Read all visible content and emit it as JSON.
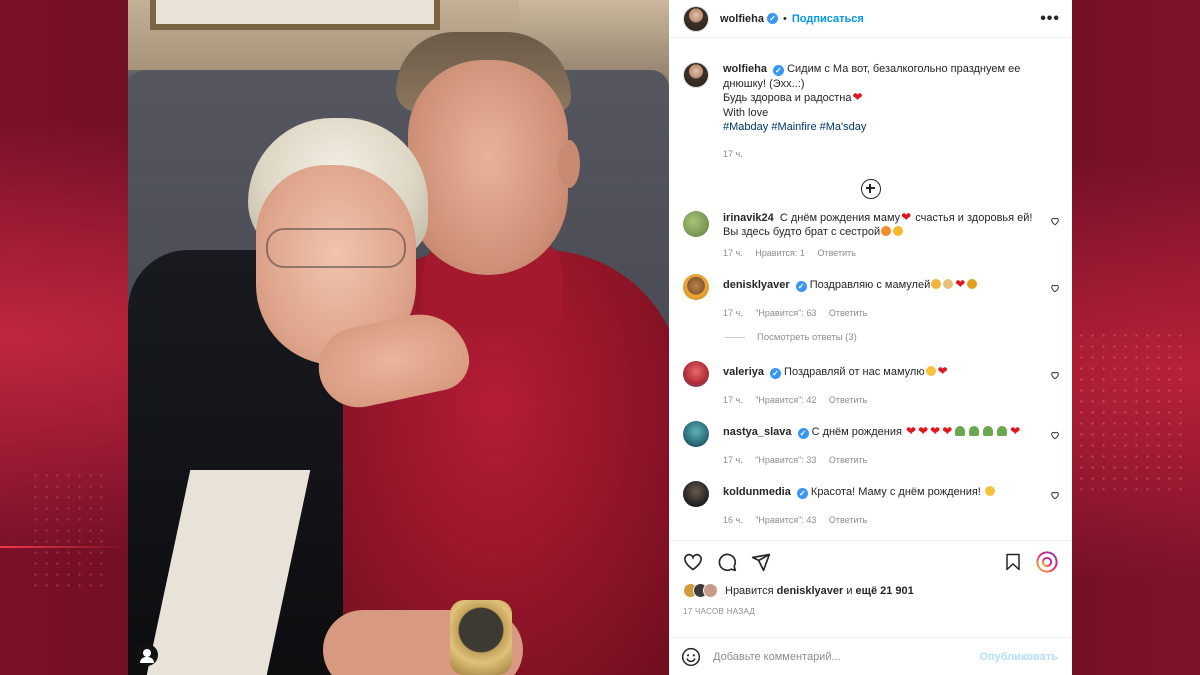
{
  "post": {
    "username": "wolfieha",
    "follow_label": "Подписаться",
    "more_label": "•••",
    "caption_line1": "Сидим с Ма вот, безалкогольно празднуем ее",
    "caption_line2": "днюшку! (Эхх..:)",
    "caption_line3": "Будь здорова и радостна",
    "caption_line4": "With love",
    "hashtags": [
      "#Mabday",
      "#Mainfire",
      "#Ma'sday"
    ],
    "caption_time": "17 ч."
  },
  "comments": [
    {
      "user": "irinavik24",
      "text_a": "С днём рождения маму",
      "text_b": " счастья и здоровья ей!",
      "text_c": "Вы здесь будто брат с сестрой",
      "time": "17 ч.",
      "likes": "Нравится: 1",
      "reply": "Ответить",
      "avatar_color": "#7a9a5a"
    },
    {
      "user": "denisklyaver",
      "text": "Поздравляю с мамулей",
      "time": "17 ч.",
      "likes": "\"Нравится\": 63",
      "reply": "Ответить",
      "view_replies": "Посмотреть ответы (3)",
      "avatar_color": "#d19a3c"
    },
    {
      "user": "valeriya",
      "text": "Поздравляй от нас мамулю",
      "time": "17 ч.",
      "likes": "\"Нравится\": 42",
      "reply": "Ответить",
      "avatar_color": "#c0303a"
    },
    {
      "user": "nastya_slava",
      "text": "С днём рождения",
      "time": "17 ч.",
      "likes": "\"Нравится\": 33",
      "reply": "Ответить",
      "avatar_color": "#2a6c7a"
    },
    {
      "user": "koldunmedia",
      "text": "Красота! Маму с днём рождения!",
      "time": "16 ч.",
      "likes": "\"Нравится\": 43",
      "reply": "Ответить",
      "avatar_color": "#2a2a2a"
    }
  ],
  "likes": {
    "prefix": "Нравится",
    "user": "denisklyaver",
    "and": "и",
    "rest": "ещё 21 901"
  },
  "timestamp": "17 ЧАСОВ НАЗАД",
  "comment_box": {
    "placeholder": "Добавьте комментарий...",
    "publish": "Опубликовать"
  },
  "icons": {
    "heart": "heart-icon",
    "comment": "comment-icon",
    "share": "share-icon",
    "save": "bookmark-icon",
    "reels": "reels-icon",
    "emoji": "emoji-icon",
    "add": "add-circle-icon",
    "user_tag": "user-tag-icon"
  },
  "colors": {
    "accent": "#0095f6",
    "verified": "#3897f0",
    "heart": "#e0171f",
    "hashtag": "#00376b"
  }
}
